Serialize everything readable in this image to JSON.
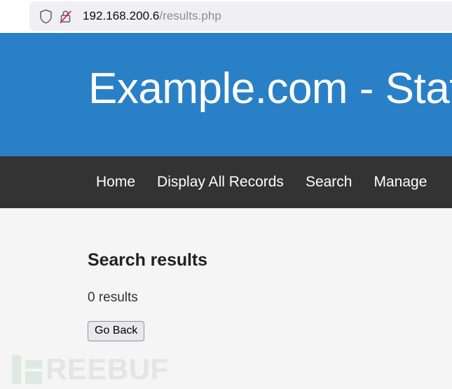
{
  "browser": {
    "url_domain": "192.168.200.6",
    "url_path": "/results.php",
    "shield_icon": "shield-icon",
    "lock_icon": "padlock-crossed-insecure-icon"
  },
  "site": {
    "title": "Example.com - Staff",
    "header_bg": "#2a80c7",
    "nav_bg": "#333333",
    "body_bg": "#f5f5f5",
    "nav": [
      {
        "label": "Home"
      },
      {
        "label": "Display All Records"
      },
      {
        "label": "Search"
      },
      {
        "label": "Manage"
      }
    ]
  },
  "main": {
    "heading": "Search results",
    "result_count_text": "0 results",
    "go_back_label": "Go Back"
  },
  "watermark": {
    "text": "REEBUF",
    "color": "#e4e4e4",
    "mark_color": "#dde9e1"
  }
}
